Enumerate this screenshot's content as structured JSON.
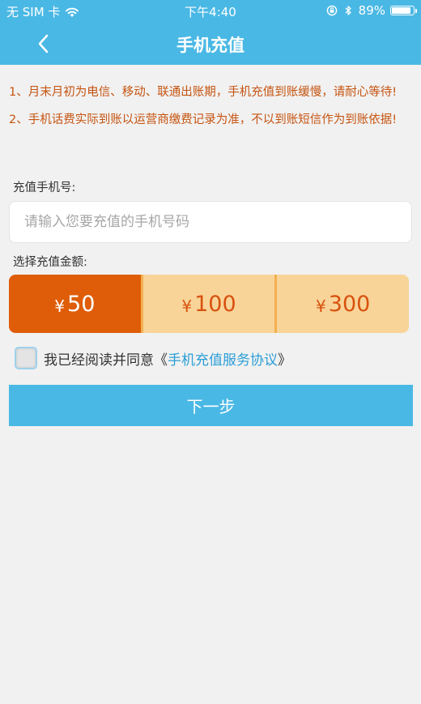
{
  "status_bar": {
    "carrier": "无 SIM 卡",
    "time": "下午4:40",
    "battery_percent": "89%",
    "battery_level": 0.89,
    "icons": [
      "wifi-icon",
      "orientation-lock-icon",
      "bluetooth-icon",
      "battery-icon"
    ]
  },
  "nav": {
    "title": "手机充值",
    "back_icon": "chevron-left-icon"
  },
  "notices": [
    "1、月末月初为电信、移动、联通出账期，手机充值到账缓慢，请耐心等待!",
    "2、手机话费实际到账以运营商缴费记录为准，不以到账短信作为到账依据!"
  ],
  "phone": {
    "label": "充值手机号:",
    "value": "",
    "placeholder": "请输入您要充值的手机号码"
  },
  "amount": {
    "label": "选择充值金额:",
    "options": [
      {
        "currency": "¥",
        "value": "50",
        "selected": true
      },
      {
        "currency": "¥",
        "value": "100",
        "selected": false
      },
      {
        "currency": "¥",
        "value": "300",
        "selected": false
      }
    ]
  },
  "agreement": {
    "checked": false,
    "text": "我已经阅读并同意《",
    "link": "手机充值服务协议",
    "suffix": "》"
  },
  "next_button": {
    "label": "下一步"
  },
  "colors": {
    "primary": "#4ab8e4",
    "notice": "#c65411",
    "amount_selected": "#df5d08",
    "amount_unselected": "#f9d499",
    "link": "#2a9ed6"
  }
}
